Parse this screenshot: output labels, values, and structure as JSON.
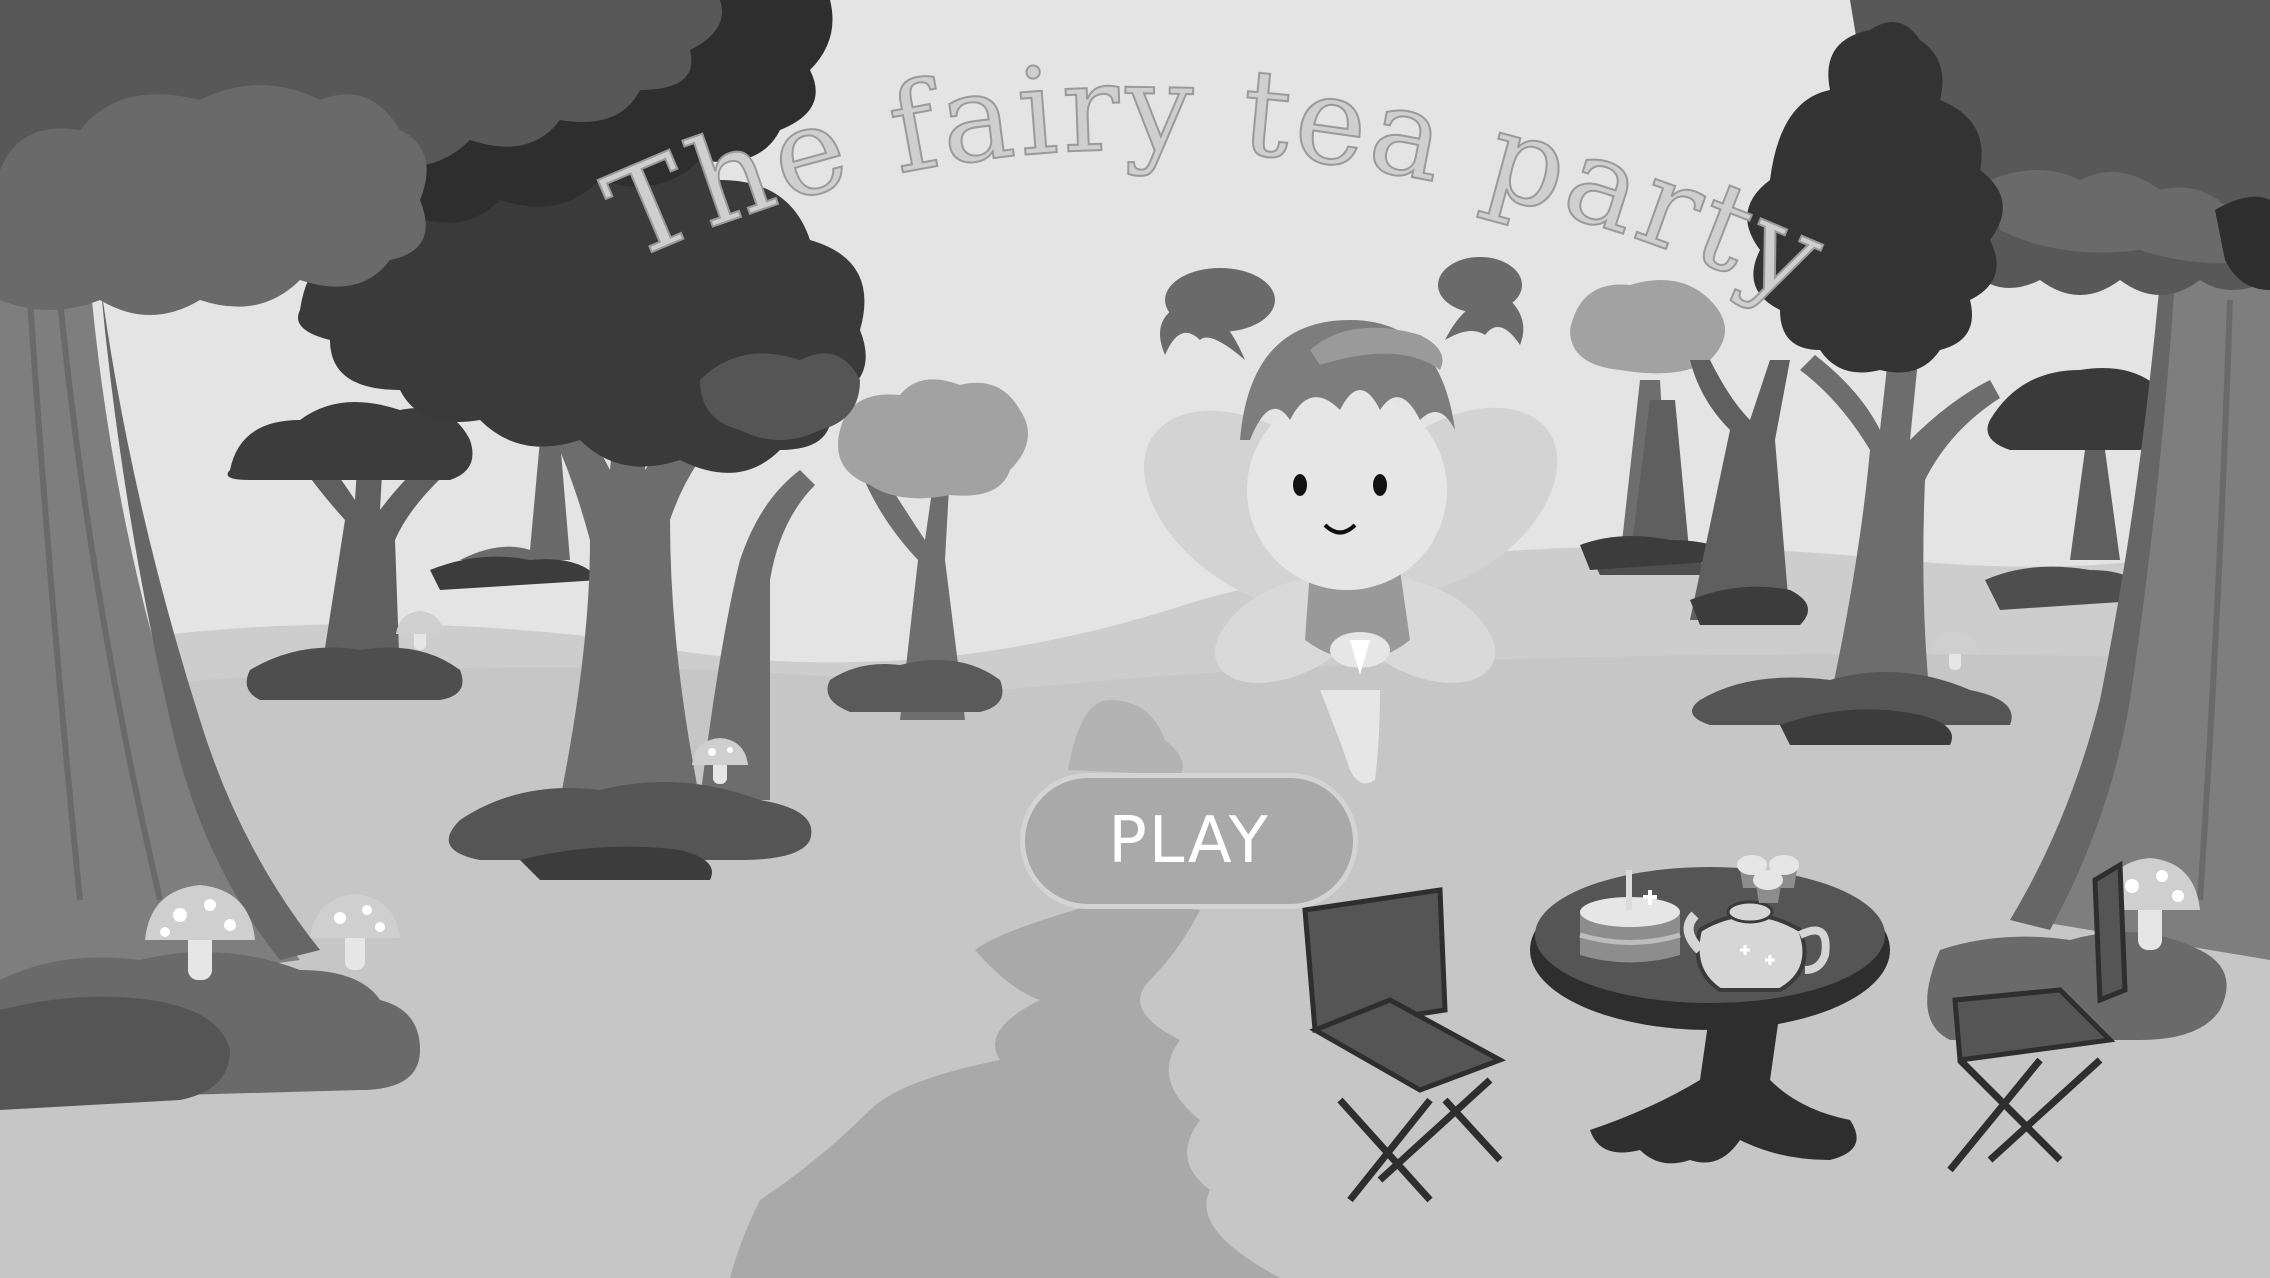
{
  "game": {
    "title": "The fairy tea party",
    "play_label": "PLAY"
  },
  "colors": {
    "sky": "#e4e4e4",
    "meadow": "#c9c9c9",
    "path": "#a9a9a9",
    "tree_dark": "#3e3e3e",
    "tree_mid": "#5a5a5a",
    "trunk": "#7a7a7a",
    "title_text": "#cfcfcf",
    "button_fill": "#a9a9a9",
    "button_border": "#d4d4d4"
  },
  "icons": {
    "characters": [
      "fairy-icon"
    ],
    "props": [
      "tea-table-icon",
      "teapot-icon",
      "birthday-cake-icon",
      "cupcake-icon",
      "folding-chair-icon",
      "mushroom-icon"
    ]
  }
}
